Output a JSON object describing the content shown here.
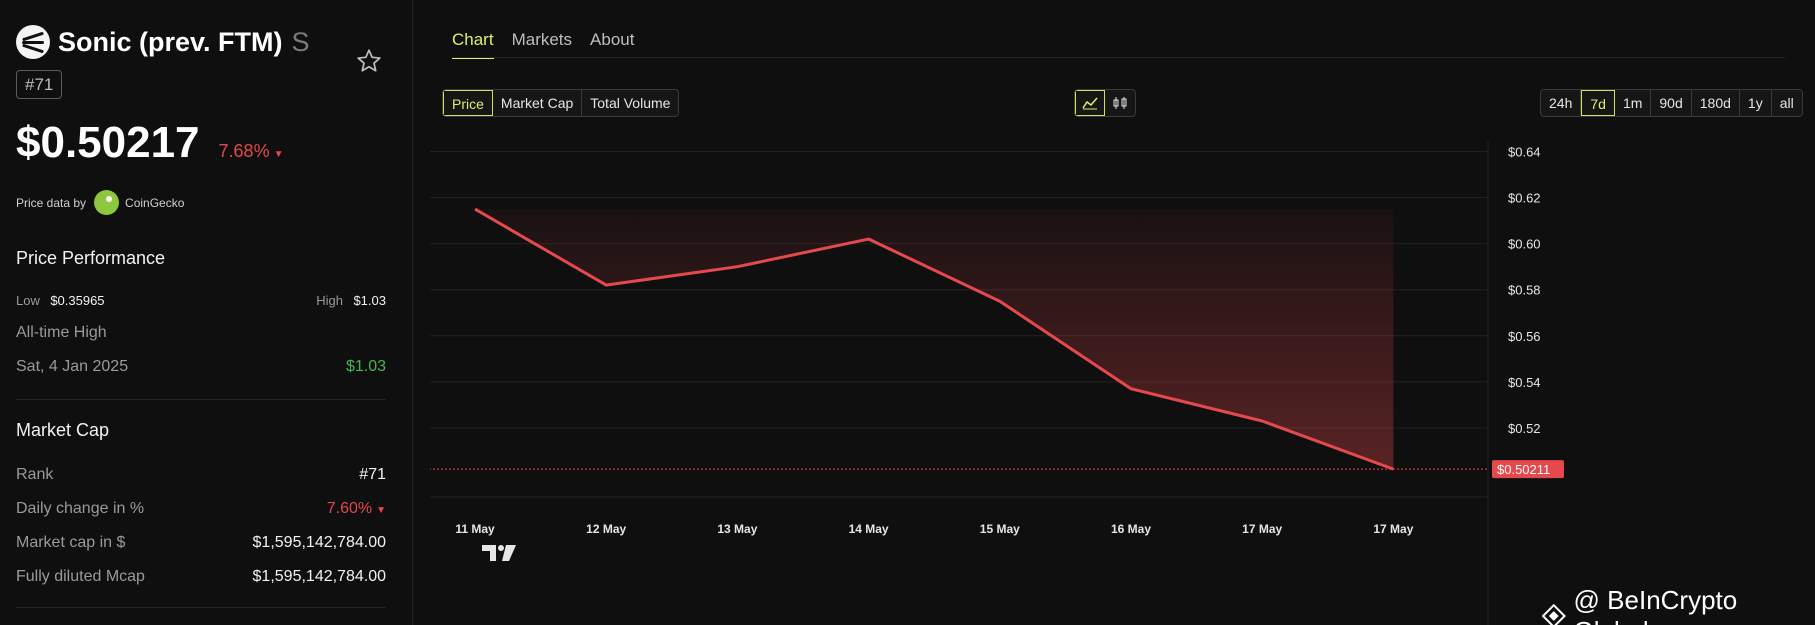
{
  "coin": {
    "name": "Sonic (prev. FTM)",
    "symbol": "S",
    "rank_badge": "#71",
    "price": "$0.50217",
    "change": "7.68%",
    "price_data_label": "Price data by",
    "provider": "CoinGecko",
    "icon": "sonic-logo-icon"
  },
  "performance": {
    "title": "Price Performance",
    "low_label": "Low",
    "low_value": "$0.35965",
    "high_label": "High",
    "high_value": "$1.03",
    "ath_label": "All-time High",
    "ath_date": "Sat, 4 Jan 2025",
    "ath_value": "$1.03"
  },
  "market_cap": {
    "title": "Market Cap",
    "rows": [
      {
        "label": "Rank",
        "value": "#71"
      },
      {
        "label": "Daily change in %",
        "value": "7.60%"
      },
      {
        "label": "Market cap in $",
        "value": "$1,595,142,784.00"
      },
      {
        "label": "Fully diluted Mcap",
        "value": "$1,595,142,784.00"
      }
    ]
  },
  "tabs": [
    "Chart",
    "Markets",
    "About"
  ],
  "metric_buttons": [
    "Price",
    "Market Cap",
    "Total Volume"
  ],
  "chart_type_icons": [
    "line-chart-icon",
    "candlestick-icon"
  ],
  "range_buttons": [
    "24h",
    "7d",
    "1m",
    "90d",
    "180d",
    "1y",
    "all"
  ],
  "current_price_tag": "$0.50211",
  "watermark": "@ BeInCrypto Global",
  "colors": {
    "accent": "#d7f36b",
    "line": "#e5484d",
    "positive": "#3fb950",
    "background": "#0f0f0f"
  },
  "chart_data": {
    "type": "area",
    "x": [
      "11 May",
      "12 May",
      "13 May",
      "14 May",
      "15 May",
      "16 May",
      "17 May"
    ],
    "series": [
      {
        "points": [
          {
            "x": 0.0,
            "y": 0.615
          },
          {
            "x": 1.0,
            "y": 0.582
          },
          {
            "x": 2.0,
            "y": 0.59
          },
          {
            "x": 3.0,
            "y": 0.602
          },
          {
            "x": 4.0,
            "y": 0.575
          },
          {
            "x": 5.0,
            "y": 0.537
          },
          {
            "x": 6.0,
            "y": 0.523
          },
          {
            "x": 7.0,
            "y": 0.5021
          }
        ]
      }
    ],
    "y_ticks": [
      "$0.64",
      "$0.62",
      "$0.60",
      "$0.58",
      "$0.56",
      "$0.54",
      "$0.52"
    ],
    "ylim": [
      0.49,
      0.645
    ],
    "x_tick_labels": [
      "11 May",
      "12 May",
      "13 May",
      "14 May",
      "15 May",
      "16 May",
      "17 May",
      "17 May"
    ],
    "grid": true
  }
}
